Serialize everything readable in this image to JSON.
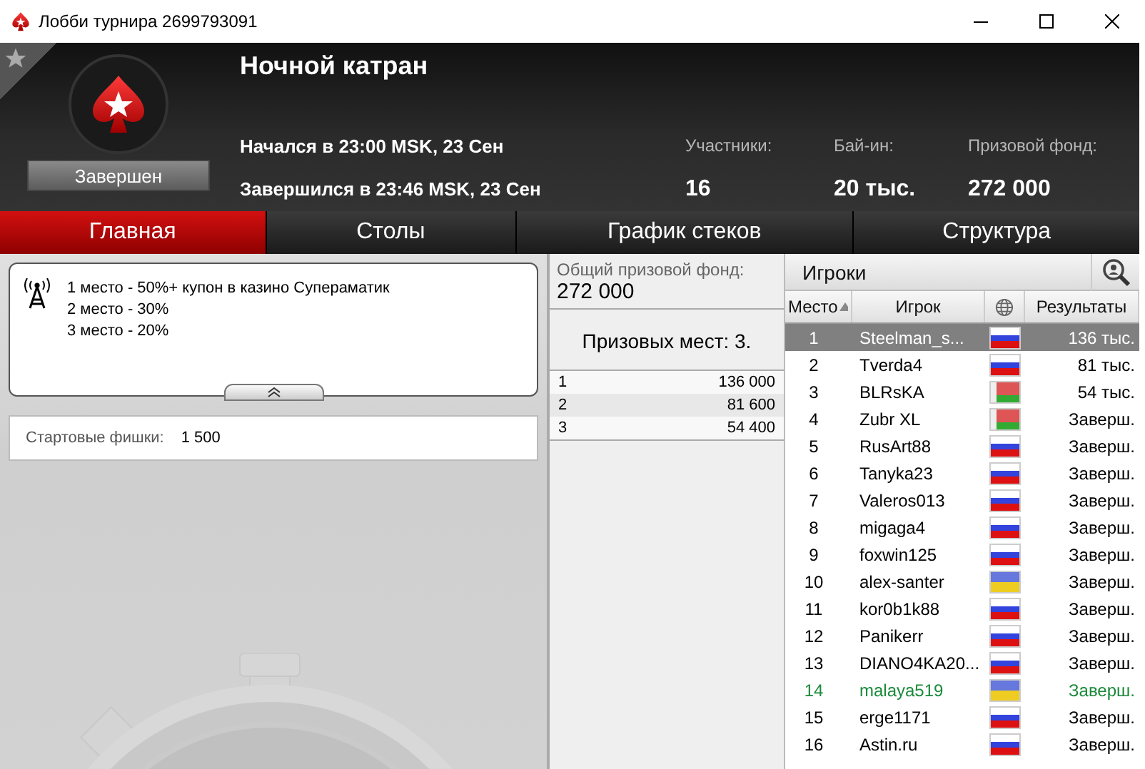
{
  "window": {
    "title": "Лобби турнира 2699793091"
  },
  "header": {
    "favorite": false,
    "name": "Ночной катран",
    "status": "Завершен",
    "started": "Начался в 23:00 MSK, 23 Сен",
    "finished": "Завершился в 23:46 MSK, 23 Сен",
    "stats": [
      {
        "label": "Участники:",
        "value": "16"
      },
      {
        "label": "Бай-ин:",
        "value": "20 тыс."
      },
      {
        "label": "Призовой фонд:",
        "value": "272 000"
      }
    ]
  },
  "tabs": [
    {
      "label": "Главная",
      "selected": true
    },
    {
      "label": "Столы",
      "selected": false
    },
    {
      "label": "График стеков",
      "selected": false
    },
    {
      "label": "Структура",
      "selected": false
    }
  ],
  "payout_notes": [
    "1 место - 50%+ купон в казино Супераматик",
    "2 место - 30%",
    "3 место - 20%"
  ],
  "starting_chips": {
    "label": "Стартовые фишки:",
    "value": "1 500"
  },
  "prize_pool": {
    "label": "Общий призовой фонд:",
    "value": "272 000",
    "places": "Призовых мест: 3.",
    "rows": [
      {
        "place": "1",
        "amount": "136 000"
      },
      {
        "place": "2",
        "amount": "81 600"
      },
      {
        "place": "3",
        "amount": "54 400"
      }
    ]
  },
  "players": {
    "title": "Игроки",
    "columns": [
      "Место",
      "Игрок",
      "Результаты"
    ],
    "rows": [
      {
        "place": "1",
        "name": "Steelman_s...",
        "kind": "ru",
        "result": "136 тыс.",
        "selected": true,
        "highlighted": false
      },
      {
        "place": "2",
        "name": "Tverda4",
        "kind": "ru",
        "result": "81 тыс.",
        "selected": false,
        "highlighted": false
      },
      {
        "place": "3",
        "name": "BLRsKA",
        "kind": "by",
        "result": "54 тыс.",
        "selected": false,
        "highlighted": false
      },
      {
        "place": "4",
        "name": "Zubr XL",
        "kind": "by",
        "result": "Заверш.",
        "selected": false,
        "highlighted": false
      },
      {
        "place": "5",
        "name": "RusArt88",
        "kind": "ru",
        "result": "Заверш.",
        "selected": false,
        "highlighted": false
      },
      {
        "place": "6",
        "name": "Tanyka23",
        "kind": "ru",
        "result": "Заверш.",
        "selected": false,
        "highlighted": false
      },
      {
        "place": "7",
        "name": "Valeros013",
        "kind": "ru",
        "result": "Заверш.",
        "selected": false,
        "highlighted": false
      },
      {
        "place": "8",
        "name": "migaga4",
        "kind": "ru",
        "result": "Заверш.",
        "selected": false,
        "highlighted": false
      },
      {
        "place": "9",
        "name": "foxwin125",
        "kind": "ru",
        "result": "Заверш.",
        "selected": false,
        "highlighted": false
      },
      {
        "place": "10",
        "name": "alex-santer",
        "kind": "ua",
        "result": "Заверш.",
        "selected": false,
        "highlighted": false
      },
      {
        "place": "11",
        "name": "kor0b1k88",
        "kind": "ru",
        "result": "Заверш.",
        "selected": false,
        "highlighted": false
      },
      {
        "place": "12",
        "name": "Panikerr",
        "kind": "ru",
        "result": "Заверш.",
        "selected": false,
        "highlighted": false
      },
      {
        "place": "13",
        "name": "DIANO4KA20...",
        "kind": "ru",
        "result": "Заверш.",
        "selected": false,
        "highlighted": false
      },
      {
        "place": "14",
        "name": "malaya519",
        "kind": "ua",
        "result": "Заверш.",
        "selected": false,
        "highlighted": true
      },
      {
        "place": "15",
        "name": "erge1171",
        "kind": "ru",
        "result": "Заверш.",
        "selected": false,
        "highlighted": false
      },
      {
        "place": "16",
        "name": "Astin.ru",
        "kind": "ru",
        "result": "Заверш.",
        "selected": false,
        "highlighted": false
      }
    ]
  }
}
